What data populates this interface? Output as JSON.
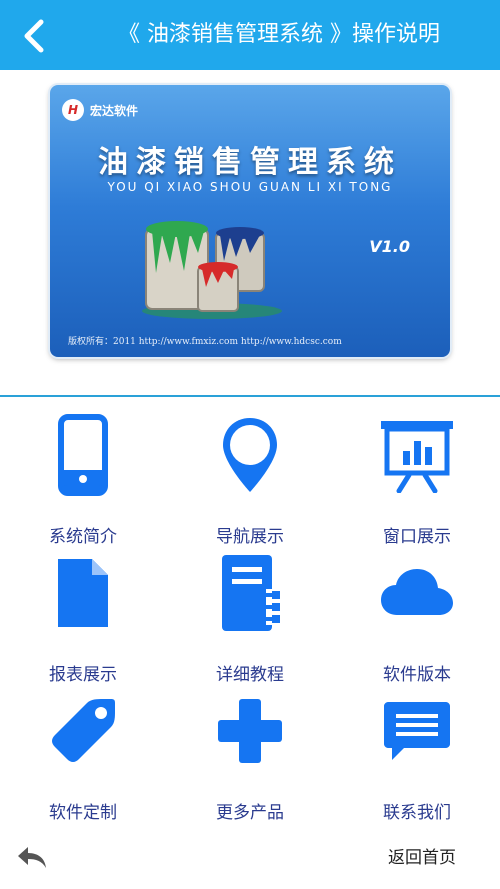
{
  "header": {
    "title": "《 油漆销售管理系统 》操作说明",
    "back_icon": "chevron-left-icon"
  },
  "banner": {
    "logo_text": "宏达软件",
    "title": "油漆销售管理系统",
    "subtitle": "YOU QI XIAO SHOU GUAN LI XI TONG",
    "version": "V1.0",
    "footer": "版权所有：2011  http://www.fmxiz.com  http://www.hdcsc.com"
  },
  "menu": [
    {
      "label": "系统简介",
      "icon": "phone-icon"
    },
    {
      "label": "导航展示",
      "icon": "map-pin-icon"
    },
    {
      "label": "窗口展示",
      "icon": "presentation-icon"
    },
    {
      "label": "报表展示",
      "icon": "document-icon"
    },
    {
      "label": "详细教程",
      "icon": "notebook-icon"
    },
    {
      "label": "软件版本",
      "icon": "cloud-icon"
    },
    {
      "label": "软件定制",
      "icon": "tag-icon"
    },
    {
      "label": "更多产品",
      "icon": "plus-icon"
    },
    {
      "label": "联系我们",
      "icon": "message-icon"
    }
  ],
  "footer": {
    "back_icon": "reply-arrow-icon",
    "home_label": "返回首页"
  },
  "colors": {
    "header_bg": "#20a8ec",
    "icon_blue": "#1575f2",
    "label_text": "#2a3b8f"
  }
}
